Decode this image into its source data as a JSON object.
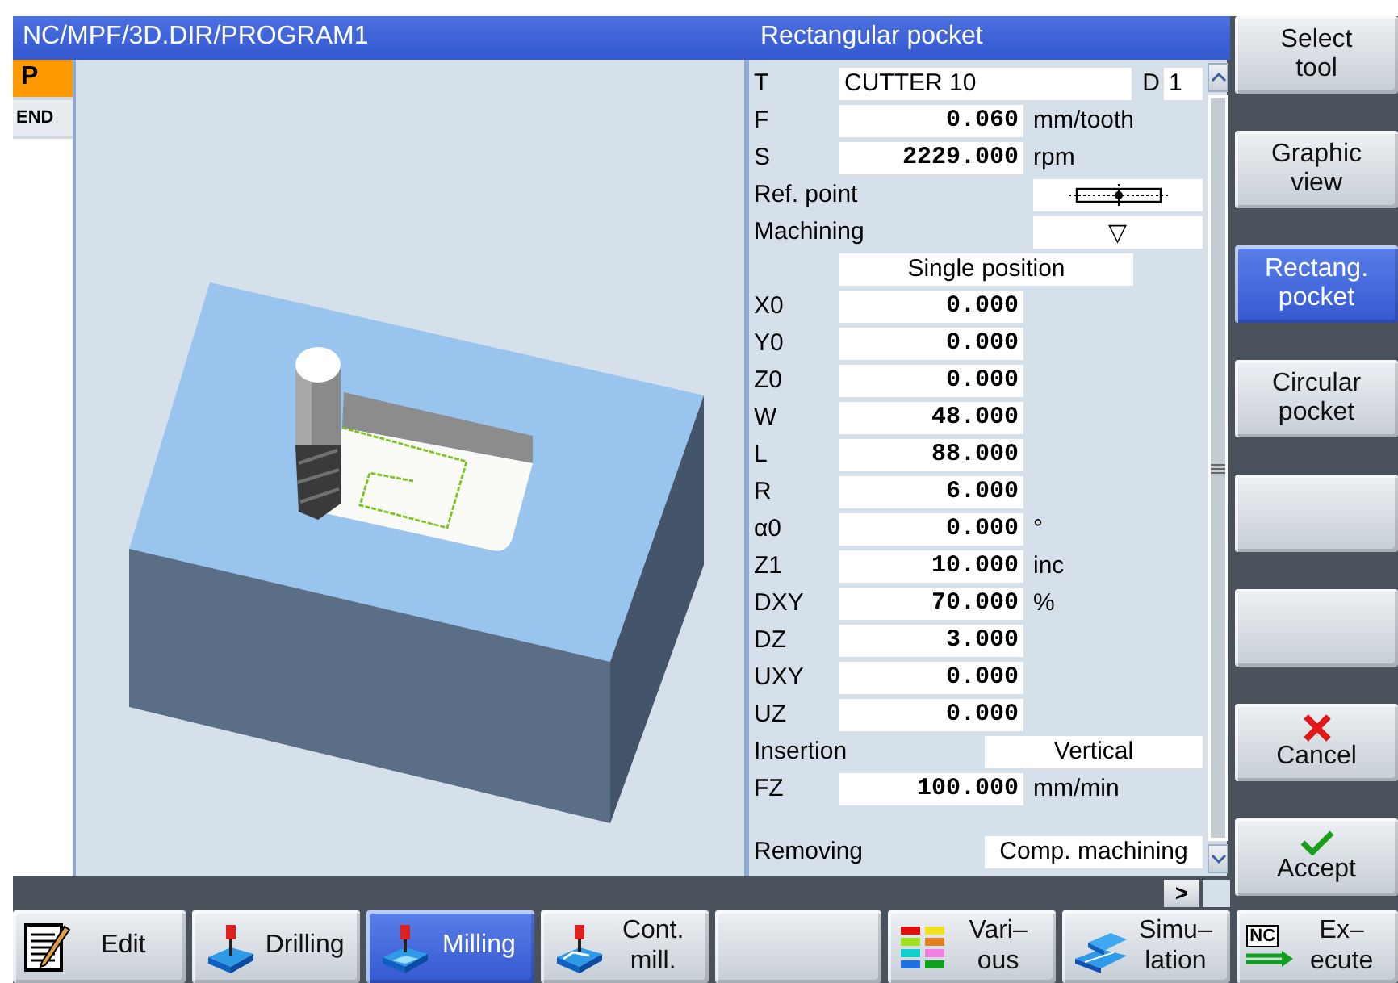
{
  "program": {
    "path": "NC/MPF/3D.DIR/PROGRAM1",
    "blocks": [
      {
        "text": "P",
        "selected": true
      },
      {
        "text": "END",
        "selected": false
      }
    ]
  },
  "form": {
    "title": "Rectangular pocket",
    "rows": [
      {
        "kind": "tool",
        "label": "T",
        "value": "CUTTER 10",
        "sub_label": "D",
        "sub_value": "1"
      },
      {
        "kind": "number",
        "label": "F",
        "value": "0.060",
        "unit": "mm/tooth"
      },
      {
        "kind": "number",
        "label": "S",
        "value": "2229.000",
        "unit": "rpm"
      },
      {
        "kind": "refpoint",
        "label": "Ref. point"
      },
      {
        "kind": "symbol",
        "label": "Machining",
        "value": "▽"
      },
      {
        "kind": "wide",
        "value": "Single position"
      },
      {
        "kind": "number",
        "label": "X0",
        "value": "0.000"
      },
      {
        "kind": "number",
        "label": "Y0",
        "value": "0.000"
      },
      {
        "kind": "number",
        "label": "Z0",
        "value": "0.000"
      },
      {
        "kind": "number",
        "label": "W",
        "value": "48.000"
      },
      {
        "kind": "number",
        "label": "L",
        "value": "88.000"
      },
      {
        "kind": "number",
        "label": "R",
        "value": "6.000"
      },
      {
        "kind": "number",
        "label": "α0",
        "value": "0.000",
        "unit": "°"
      },
      {
        "kind": "number",
        "label": "Z1",
        "value": "10.000",
        "unit": "inc"
      },
      {
        "kind": "number",
        "label": "DXY",
        "value": "70.000",
        "unit": "%"
      },
      {
        "kind": "number",
        "label": "DZ",
        "value": "3.000"
      },
      {
        "kind": "number",
        "label": "UXY",
        "value": "0.000"
      },
      {
        "kind": "number",
        "label": "UZ",
        "value": "0.000"
      },
      {
        "kind": "choice",
        "label": "Insertion",
        "value": "Vertical"
      },
      {
        "kind": "number",
        "label": "FZ",
        "value": "100.000",
        "unit": "mm/min"
      }
    ],
    "footer": {
      "label": "Removing",
      "value": "Comp. machining"
    },
    "more_button": ">"
  },
  "vertical_softkeys": [
    {
      "label": "Select\ntool",
      "selected": false
    },
    {
      "label": "Graphic\nview",
      "selected": false
    },
    {
      "label": "Rectang.\npocket",
      "selected": true
    },
    {
      "label": "Circular\npocket",
      "selected": false
    },
    {
      "selected": false
    },
    {
      "selected": false
    },
    {
      "label": "Cancel",
      "kind": "cancel",
      "selected": false
    },
    {
      "label": "Accept",
      "kind": "accept",
      "selected": false
    }
  ],
  "horizontal_softkeys": [
    {
      "label": "Edit",
      "kind": "edit",
      "selected": false
    },
    {
      "label": "Drilling",
      "kind": "drilling",
      "selected": false
    },
    {
      "label": "Milling",
      "kind": "milling",
      "selected": true
    },
    {
      "label": "Cont.\nmill.",
      "kind": "contour",
      "selected": false
    },
    {
      "selected": false
    },
    {
      "label": "Vari–\nous",
      "kind": "various",
      "selected": false
    },
    {
      "label": "Simu–\nlation",
      "kind": "simulation",
      "selected": false
    },
    {
      "label": "Ex–\necute",
      "kind": "execute",
      "badge": "NC",
      "selected": false
    }
  ]
}
